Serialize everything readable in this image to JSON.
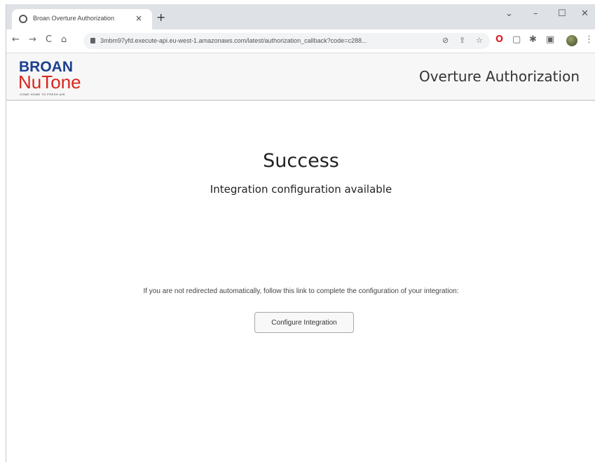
{
  "browser": {
    "tab": {
      "title": "Broan Overture Authorization",
      "close": "×"
    },
    "new_tab": "+",
    "window_controls": {
      "chevron": "⌄",
      "minimize": "–",
      "maximize": "☐",
      "close": "✕"
    },
    "nav": {
      "back": "←",
      "forward": "→",
      "reload": "C",
      "home": "⌂"
    },
    "address": {
      "url": "3mbm97yfd.execute-api.eu-west-1.amazonaws.com/latest/authorization_callback?code=c288..."
    }
  },
  "header": {
    "logo_top": "BROAN",
    "logo_bottom": "NuTone",
    "logo_tagline": "COME HOME TO FRESH AIR",
    "title": "Overture Authorization"
  },
  "main": {
    "title": "Success",
    "subtitle": "Integration configuration available",
    "redirect_text": "If you are not redirected automatically, follow this link to complete the configuration of your integration:",
    "configure_button": "Configure Integration"
  },
  "colors": {
    "brand_blue": "#1b3f8f",
    "brand_red": "#d9261c"
  }
}
